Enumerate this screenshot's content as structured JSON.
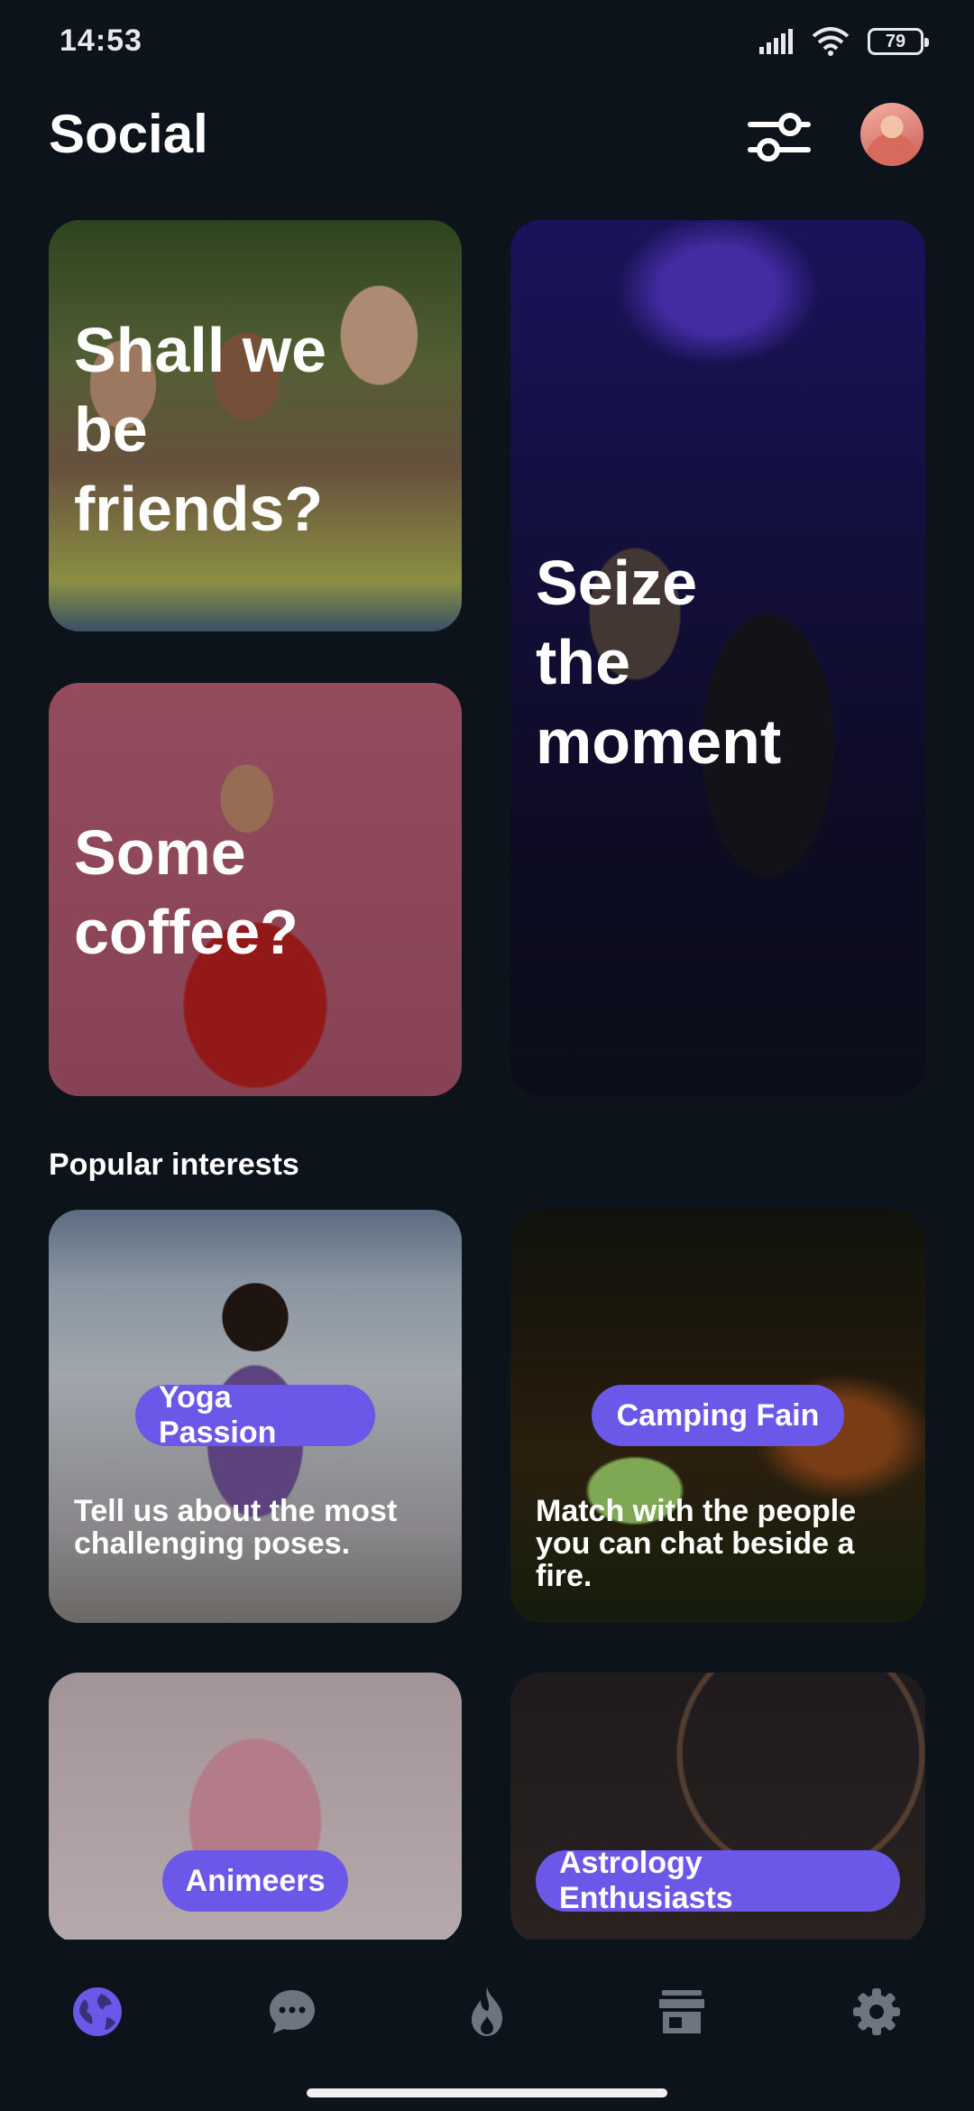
{
  "status_bar": {
    "time": "14:53",
    "battery": "79"
  },
  "header": {
    "title": "Social",
    "filter_icon": "sliders-icon",
    "avatar_icon": "user-avatar"
  },
  "featured": [
    {
      "title": "Shall we\nbe\nfriends?"
    },
    {
      "title": "Some\ncoffee?"
    },
    {
      "title": "Seize\nthe\nmoment"
    }
  ],
  "popular": {
    "label": "Popular interests",
    "items": [
      {
        "tag": "Yoga Passion",
        "description": "Tell us about the most challenging poses."
      },
      {
        "tag": "Camping Fain",
        "description": "Match with the people you can chat beside a fire."
      },
      {
        "tag": "Animeers"
      },
      {
        "tag": "Astrology Enthusiasts"
      }
    ]
  },
  "nav": {
    "items": [
      "globe-icon",
      "chat-icon",
      "flame-icon",
      "store-icon",
      "gear-icon"
    ],
    "active_color": "#6b57e8",
    "inactive_color": "#6e7580"
  },
  "colors": {
    "background": "#0d131b",
    "accent": "#6b57e8"
  }
}
